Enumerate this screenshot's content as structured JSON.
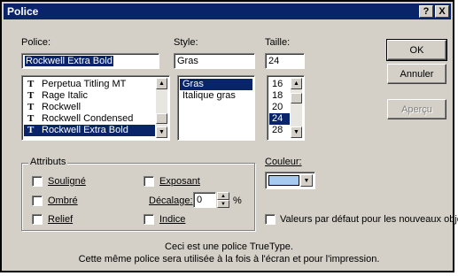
{
  "window": {
    "title": "Police",
    "help_btn": "?",
    "close_btn": "X"
  },
  "font": {
    "label": "Police:",
    "value": "Rockwell Extra Bold",
    "items": [
      {
        "label": "Perpetua Titling MT",
        "icon": "truetype-icon"
      },
      {
        "label": "Rage Italic",
        "icon": "truetype-icon"
      },
      {
        "label": "Rockwell",
        "icon": "truetype-icon"
      },
      {
        "label": "Rockwell Condensed",
        "icon": "truetype-icon"
      },
      {
        "label": "Rockwell Extra Bold",
        "icon": "truetype-icon",
        "selected": true
      }
    ]
  },
  "style": {
    "label": "Style:",
    "value": "Gras",
    "items": [
      {
        "label": "Gras",
        "selected": true
      },
      {
        "label": "Italique gras"
      }
    ]
  },
  "size": {
    "label": "Taille:",
    "value": "24",
    "items": [
      {
        "label": "16"
      },
      {
        "label": "18"
      },
      {
        "label": "20"
      },
      {
        "label": "24",
        "selected": true
      },
      {
        "label": "28"
      }
    ]
  },
  "buttons": {
    "ok": "OK",
    "cancel": "Annuler",
    "preview": "Aperçu"
  },
  "attributes": {
    "title": "Attributs",
    "underline": "Souligné",
    "shadow": "Ombré",
    "relief": "Relief",
    "superscript": "Exposant",
    "offset_label": "Décalage:",
    "offset_value": "0",
    "offset_unit": "%",
    "subscript": "Indice"
  },
  "color": {
    "label": "Couleur:",
    "value_color": "#a6caf0"
  },
  "default_checkbox": "Valeurs par défaut pour les nouveaux objets",
  "info": {
    "line1": "Ceci est une police TrueType.",
    "line2": "Cette même police sera utilisée à la fois à l'écran et pour l'impression."
  },
  "colors": {
    "titlebar": "#0a246a",
    "face": "#d4d0c8",
    "selection": "#0a246a"
  }
}
